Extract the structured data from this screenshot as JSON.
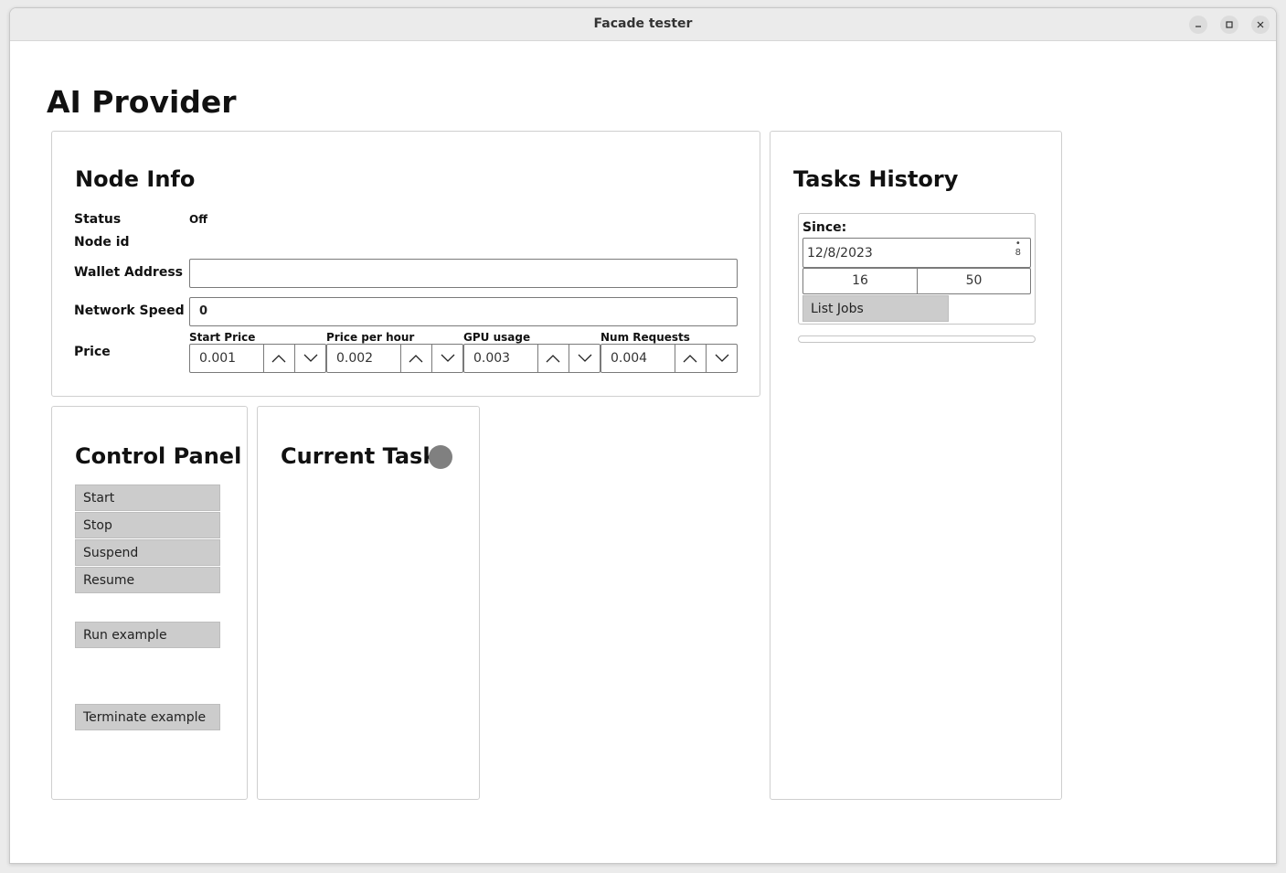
{
  "window": {
    "title": "Facade tester"
  },
  "page": {
    "title": "AI Provider"
  },
  "node_info": {
    "title": "Node Info",
    "status_label": "Status",
    "status_value": "Off",
    "node_id_label": "Node id",
    "wallet_label": "Wallet Address",
    "wallet_value": "",
    "network_label": "Network Speed",
    "network_value": "0",
    "price_label": "Price",
    "prices": [
      {
        "label": "Start Price",
        "value": "0.001"
      },
      {
        "label": "Price per hour",
        "value": "0.002"
      },
      {
        "label": "GPU usage",
        "value": "0.003"
      },
      {
        "label": "Num Requests",
        "value": "0.004"
      }
    ]
  },
  "control_panel": {
    "title": "Control Panel",
    "buttons": [
      "Start",
      "Stop",
      "Suspend",
      "Resume",
      "Run example",
      "Terminate example"
    ]
  },
  "current_task": {
    "title": "Current Task",
    "indicator_color": "#808080"
  },
  "tasks_history": {
    "title": "Tasks History",
    "since_label": "Since:",
    "date_value": "12/8/2023",
    "date_spinner_text": "8",
    "hour": "16",
    "minute": "50",
    "list_jobs_label": "List Jobs"
  }
}
